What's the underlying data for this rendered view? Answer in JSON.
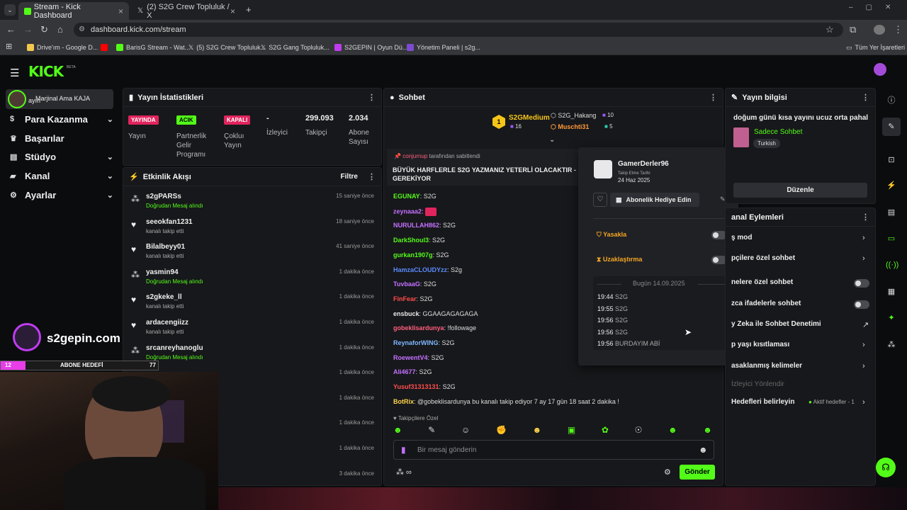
{
  "browser": {
    "tabs": [
      {
        "title": "Stream - Kick Dashboard"
      },
      {
        "title": "(2) S2G Crew Topluluk / X"
      }
    ],
    "url": "dashboard.kick.com/stream",
    "bookmarks": [
      {
        "label": "Drive'ım - Google D...",
        "color": "#f2c94c"
      },
      {
        "label": "",
        "color": "#ff0000"
      },
      {
        "label": "BarisG Stream - Wat...",
        "color": "#53fc18"
      },
      {
        "label": "(5) S2G Crew Topluluk...",
        "color": "#ffffff"
      },
      {
        "label": "S2G Gang Topluluk...",
        "color": "#ffffff"
      },
      {
        "label": "S2GEPIN | Oyun Dü...",
        "color": "#c03cf0"
      },
      {
        "label": "Yönetim Paneli | s2g...",
        "color": "#7b4bd1"
      }
    ],
    "all_bookmarks": "Tüm Yer İşaretleri"
  },
  "kick": {
    "logo": "KICK",
    "logo_beta": "BETA",
    "accent": "#53fc18"
  },
  "sidebar": {
    "channel_tag": "Marjinal Ama KAJA",
    "channel_sub": "ayın",
    "items": [
      {
        "label": "Para Kazanma",
        "icon": "dollar-icon",
        "chev": true
      },
      {
        "label": "Başarılar",
        "icon": "trophy-icon",
        "chev": false
      },
      {
        "label": "Stüdyo",
        "icon": "studio-icon",
        "chev": true
      },
      {
        "label": "Kanal",
        "icon": "channel-icon",
        "chev": true
      },
      {
        "label": "Ayarlar",
        "icon": "gear-icon",
        "chev": true
      }
    ]
  },
  "stats": {
    "title": "Yayın İstatistikleri",
    "cols": [
      {
        "badge": "YAYINDA",
        "badge_color": "#e0245e",
        "label": "Yayın"
      },
      {
        "badge": "ACIK",
        "badge_color": "#53fc18",
        "label": "Partnerlik Gelir Programı"
      },
      {
        "badge": "KAPALI",
        "badge_color": "#e0245e",
        "label": "Çokluı Yayın"
      },
      {
        "value": "-",
        "label": "İzleyici"
      },
      {
        "value": "299.093",
        "label": "Takipçi"
      },
      {
        "value": "2.034",
        "label": "Abone Sayısı"
      }
    ]
  },
  "activity": {
    "title": "Etkinlik Akışı",
    "filter": "Filtre",
    "items": [
      {
        "name": "s2gPARSs",
        "sub": "Doğrudan Mesaj alındı",
        "time": "15 saniye önce",
        "icon": "gift-icon"
      },
      {
        "name": "seeokfan1231",
        "sub": "kanalı takip etti",
        "time": "18 saniye önce",
        "icon": "heart-icon"
      },
      {
        "name": "Bilalbeyy01",
        "sub": "kanalı takip etti",
        "time": "41 saniye önce",
        "icon": "heart-icon"
      },
      {
        "name": "yasmin94",
        "sub": "Doğrudan Mesaj alındı",
        "time": "1 dakika önce",
        "icon": "gift-icon"
      },
      {
        "name": "s2gkeke_ll",
        "sub": "kanalı takip etti",
        "time": "1 dakika önce",
        "icon": "heart-icon"
      },
      {
        "name": "ardacengiizz",
        "sub": "kanalı takip etti",
        "time": "1 dakika önce",
        "icon": "heart-icon"
      },
      {
        "name": "srcanreyhanoglu",
        "sub": "Doğrudan Mesaj alındı",
        "time": "1 dakika önce",
        "icon": "gift-icon"
      },
      {
        "name": "",
        "sub": "",
        "time": "1 dakika önce",
        "icon": ""
      },
      {
        "name": "",
        "sub": "",
        "time": "1 dakika önce",
        "icon": ""
      },
      {
        "name": "",
        "sub": "",
        "time": "1 dakika önce",
        "icon": ""
      },
      {
        "name": "",
        "sub": "",
        "time": "1 dakika önce",
        "icon": ""
      },
      {
        "name": "",
        "sub": "",
        "time": "3 dakika önce",
        "icon": ""
      }
    ]
  },
  "overlay": {
    "site": "s2gepin.com",
    "goal_start": "12",
    "goal_label": "ABONE HEDEFİ",
    "goal_end": "77",
    "goal_progress": 0.156
  },
  "chat": {
    "title": "Sohbet",
    "top": {
      "leader_rank": "1",
      "leader": "S2GMedium",
      "leader_count": "16",
      "second": "S2G_Hakang",
      "second_count": "10",
      "third": "Muschti31",
      "third_count": "5"
    },
    "pinned_by": "conjurnup",
    "pinned_suffix": "tarafından sabitlendi",
    "pinned_text": "BÜYÜK HARFLERLE S2G YAZMANIZ YETERLİ OLACAKTIR - GEREKİYOR",
    "messages": [
      {
        "user": "EGUNAY",
        "color": "#53fc18",
        "text": "S2G"
      },
      {
        "user": "zeynaaa2",
        "color": "#c471ff",
        "text": ""
      },
      {
        "user": "NURULLAH862",
        "color": "#c471ff",
        "text": "S2G"
      },
      {
        "user": "DarkShoul3",
        "color": "#53fc18",
        "text": "S2G"
      },
      {
        "user": "gurkan1907g",
        "color": "#53fc18",
        "text": "S2G"
      },
      {
        "user": "HamzaCLOUDYzz",
        "color": "#5b8bff",
        "text": "S2g"
      },
      {
        "user": "TuvbaaG",
        "color": "#c471ff",
        "text": "S2G"
      },
      {
        "user": "FinFear",
        "color": "#ff4d4d",
        "text": "S2G"
      },
      {
        "user": "ensbuck",
        "color": "#e8e8ea",
        "text": "GGAAGAGAGAGA"
      },
      {
        "user": "gobeklisardunya",
        "color": "#ff5e7e",
        "text": "!followage"
      },
      {
        "user": "ReynaforWING",
        "color": "#7fb8ff",
        "text": "S2G"
      },
      {
        "user": "RoewentV4",
        "color": "#c471ff",
        "text": "S2G"
      },
      {
        "user": "Ali4677",
        "color": "#c471ff",
        "text": "S2G"
      },
      {
        "user": "Yusuf31313131",
        "color": "#ff4d4d",
        "text": "S2G"
      },
      {
        "user": "BotRix",
        "color": "#ffd34d",
        "text": "@gobeklisardunya bu kanalı takip ediyor 7 ay 17 gün 18 saat 2 dakika !"
      }
    ],
    "followers_only": "Takipçilere Özel",
    "placeholder": "Bir mesaj gönderin",
    "send": "Gönder"
  },
  "popup": {
    "username": "GamerDerler96",
    "follow_label": "Takip Etme Tarihi",
    "follow_date": "24 Haz 2025",
    "gift_sub": "Abonelik Hediye Edin",
    "ban": "Yasakla",
    "timeout": "Uzaklaştırma",
    "today": "Bugün 14.09.2025",
    "log": [
      {
        "time": "19:44",
        "text": "S2G"
      },
      {
        "time": "19:55",
        "text": "S2G"
      },
      {
        "time": "19:56",
        "text": "S2G"
      },
      {
        "time": "19:56",
        "text": "S2G"
      },
      {
        "time": "19:56",
        "text": "BURDAYIM ABİ"
      }
    ]
  },
  "streaminfo": {
    "title": "Yayın bilgisi",
    "stream_title": "doğum günü kısa yayını ucuz orta pahalıs",
    "category": "Sadece Sohbet",
    "tag": "Turkish",
    "edit": "Düzenle"
  },
  "actions": {
    "title": "anal Eylemleri",
    "items": [
      {
        "label": "ş mod",
        "kind": "chev"
      },
      {
        "label": "pçilere özel sohbet",
        "kind": "chev"
      },
      {
        "label": "nelere özel sohbet",
        "kind": "toggle"
      },
      {
        "label": "zca ifadelerle sohbet",
        "kind": "toggle"
      },
      {
        "label": "y Zeka ile Sohbet Denetimi",
        "kind": "ext"
      },
      {
        "label": "p yaşı kısıtlaması",
        "kind": "chev"
      },
      {
        "label": "asaklanmış kelimeler",
        "kind": "chev"
      }
    ],
    "redirect": "İzleyici Yönlendir",
    "goals": "Hedefleri belirleyin",
    "goals_status": "Aktif hedefler - 1"
  }
}
